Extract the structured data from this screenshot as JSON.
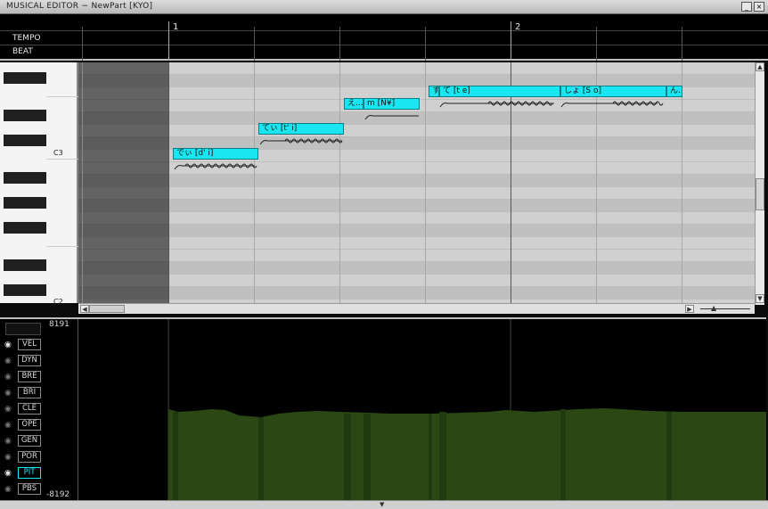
{
  "window": {
    "title": "MUSICAL EDITOR − NewPart [KYO]",
    "minimize_label": "_",
    "close_label": "×"
  },
  "ruler": {
    "tempo_label": "TEMPO",
    "beat_label": "BEAT",
    "bar_numbers": [
      "1",
      "2"
    ]
  },
  "piano": {
    "c3_label": "C3",
    "c2_label": "C2"
  },
  "notes": [
    {
      "lyric": "でぃ [d' i]"
    },
    {
      "lyric": "てぃ [t' i]"
    },
    {
      "lyric": "え..."
    },
    {
      "lyric": "m [N¥]"
    },
    {
      "lyric": "す"
    },
    {
      "lyric": "て [t e]"
    },
    {
      "lyric": "しょ [S o]"
    },
    {
      "lyric": "ん.."
    }
  ],
  "control": {
    "max_label": "8191",
    "min_label": "-8192",
    "params": [
      {
        "label": "VEL",
        "visible": true
      },
      {
        "label": "DYN",
        "visible": false
      },
      {
        "label": "BRE",
        "visible": false
      },
      {
        "label": "BRI",
        "visible": false
      },
      {
        "label": "CLE",
        "visible": false
      },
      {
        "label": "OPE",
        "visible": false
      },
      {
        "label": "GEN",
        "visible": false
      },
      {
        "label": "POR",
        "visible": false
      },
      {
        "label": "PIT",
        "visible": true,
        "active": true
      },
      {
        "label": "PBS",
        "visible": false
      }
    ],
    "active_param": "PIT"
  },
  "colors": {
    "note_fill": "#19e6f0",
    "curve_fill": "#2a4714",
    "active_param_text": "#19e6f0"
  }
}
